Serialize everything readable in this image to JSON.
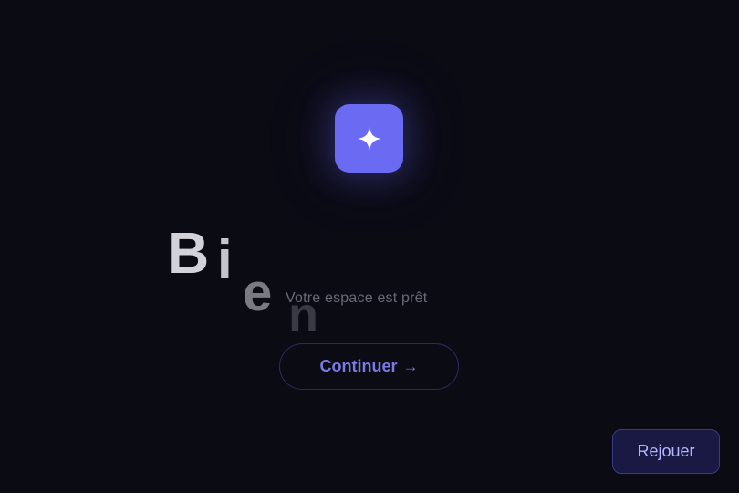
{
  "welcome": {
    "letters": [
      "B",
      "i",
      "e",
      "n"
    ]
  },
  "subtitle": "Votre espace est prêt",
  "continue_button": {
    "label": "Continuer",
    "arrow": "→"
  },
  "replay_button": {
    "label": "Rejouer"
  },
  "icons": {
    "logo": "sparkle-icon"
  },
  "colors": {
    "background": "#0b0b14",
    "accent": "#6a6af2",
    "button_text": "#7a7ae6",
    "replay_bg": "#191944"
  }
}
